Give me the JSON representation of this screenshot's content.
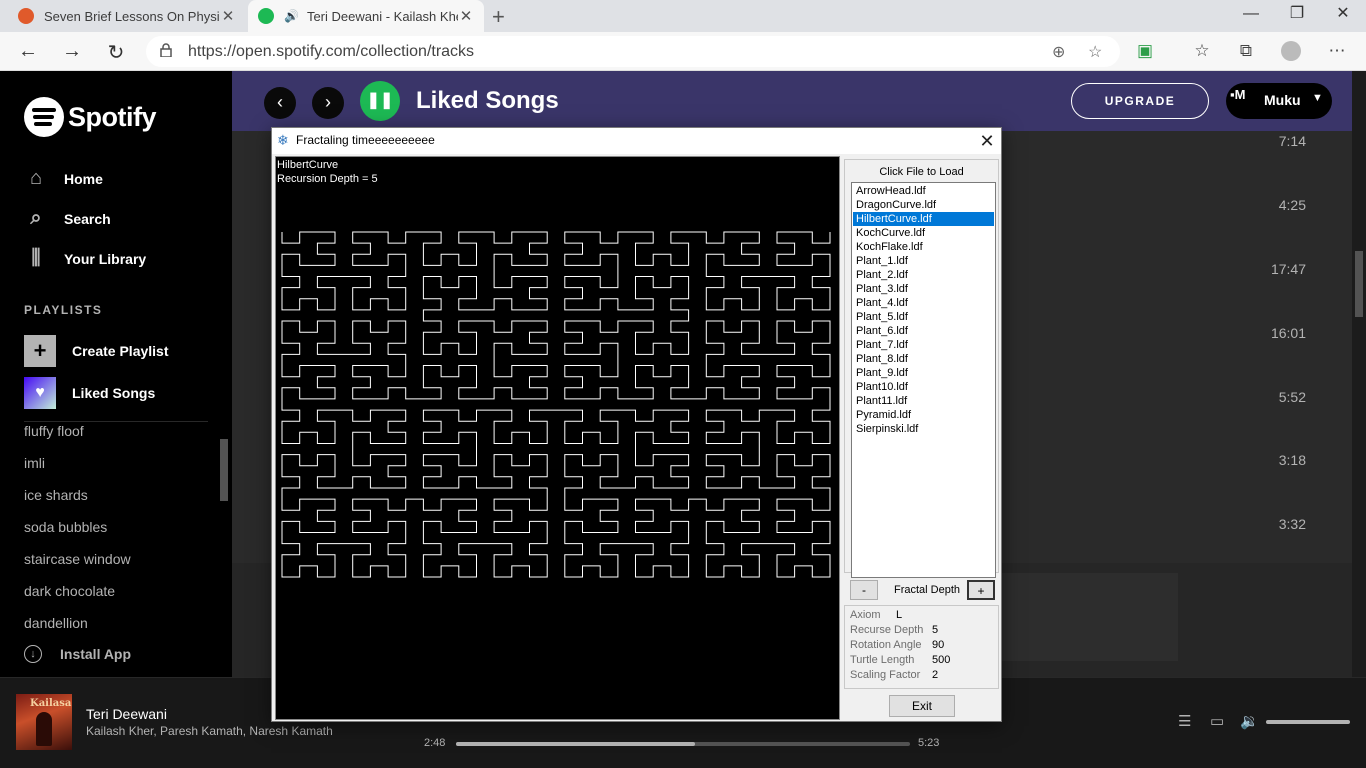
{
  "browser": {
    "tabs": [
      {
        "title": "Seven Brief Lessons On Physics -",
        "active": false
      },
      {
        "title": "Teri Deewani - Kailash Kher,",
        "active": true
      }
    ],
    "url": "https://open.spotify.com/collection/tracks"
  },
  "spotify": {
    "logo_text": "Spotify",
    "nav": [
      {
        "label": "Home",
        "icon": "home-icon"
      },
      {
        "label": "Search",
        "icon": "search-icon"
      },
      {
        "label": "Your Library",
        "icon": "library-icon"
      }
    ],
    "playlists_heading": "PLAYLISTS",
    "create_playlist": "Create Playlist",
    "liked_songs": "Liked Songs",
    "playlists": [
      "fluffy floof",
      "imli",
      "ice shards",
      "soda bubbles",
      "staircase window",
      "dark chocolate",
      "dandellion"
    ],
    "install_app": "Install App",
    "header_title": "Liked Songs",
    "upgrade": "UPGRADE",
    "user_name": "Muku",
    "avatar_alt": "M",
    "durations": [
      "7:14",
      "4:25",
      "17:47",
      "16:01",
      "5:52",
      "3:18",
      "3:32"
    ],
    "colors": {
      "accent": "#1db954",
      "header": "#3a3569"
    }
  },
  "player": {
    "song": "Teri Deewani",
    "artists": "Kailash Kher, Paresh Kamath, Naresh Kamath",
    "album_text": "Kailasa",
    "elapsed": "2:48",
    "total": "5:23",
    "progress": 0.527,
    "volume": 1.0
  },
  "dialog": {
    "title": "Fractaling timeeeeeeeeee",
    "curve_name": "HilbertCurve",
    "recursion_text": "Recursion Depth = 5",
    "list_label": "Click File to Load",
    "files": [
      "ArrowHead.ldf",
      "DragonCurve.ldf",
      "HilbertCurve.ldf",
      "KochCurve.ldf",
      "KochFlake.ldf",
      "Plant_1.ldf",
      "Plant_2.ldf",
      "Plant_3.ldf",
      "Plant_4.ldf",
      "Plant_5.ldf",
      "Plant_6.ldf",
      "Plant_7.ldf",
      "Plant_8.ldf",
      "Plant_9.ldf",
      "Plant10.ldf",
      "Plant11.ldf",
      "Pyramid.ldf",
      "Sierpinski.ldf"
    ],
    "selected_index": 2,
    "minus": "-",
    "plus": "+",
    "depth_label": "Fractal Depth",
    "params": [
      {
        "label": "Axiom",
        "value": "L"
      },
      {
        "label": "Recurse Depth",
        "value": "5"
      },
      {
        "label": "Rotation Angle",
        "value": "90"
      },
      {
        "label": "Turtle Length",
        "value": "500"
      },
      {
        "label": "Scaling Factor",
        "value": "2"
      }
    ],
    "exit": "Exit",
    "fractal": {
      "depth": 5,
      "angle": 90,
      "color": "#ffffff"
    }
  }
}
